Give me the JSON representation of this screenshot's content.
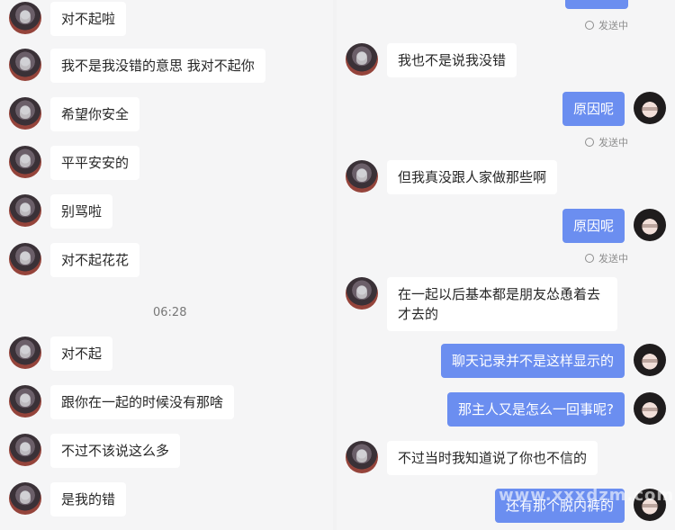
{
  "left": {
    "messages": [
      {
        "text": "对不起啦"
      },
      {
        "text": "我不是我没错的意思 我对不起你"
      },
      {
        "text": "希望你安全"
      },
      {
        "text": "平平安安的"
      },
      {
        "text": "别骂啦"
      },
      {
        "text": "对不起花花"
      },
      {
        "text": "对不起"
      },
      {
        "text": "跟你在一起的时候没有那啥"
      },
      {
        "text": "不过不该说这么多"
      },
      {
        "text": "是我的错"
      }
    ],
    "timestamp": "06:28"
  },
  "right": {
    "status_label": "发送中",
    "messages": [
      {
        "text": "我也不是说我没错"
      },
      {
        "text": "原因呢"
      },
      {
        "text": "但我真没跟人家做那些啊"
      },
      {
        "text": "原因呢"
      },
      {
        "text": "在一起以后基本都是朋友怂恿着去\n才去的"
      },
      {
        "text": "聊天记录并不是这样显示的"
      },
      {
        "text": "那主人又是怎么一回事呢?"
      },
      {
        "text": "不过当时我知道说了你也不信的"
      },
      {
        "text": "还有那个脱内裤的"
      }
    ]
  },
  "watermark": "www.xxxdzm.com"
}
